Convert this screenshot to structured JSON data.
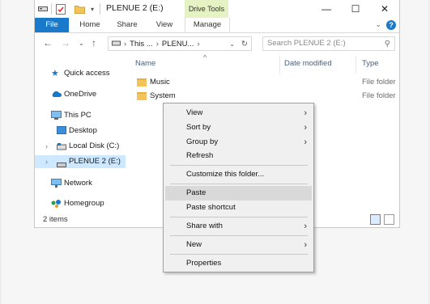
{
  "window": {
    "title": "PLENUE 2 (E:)",
    "context_tab": "Drive Tools",
    "controls": {
      "minimize": "—",
      "maximize": "☐",
      "close": "✕"
    }
  },
  "ribbon": {
    "tabs": [
      "File",
      "Home",
      "Share",
      "View",
      "Manage"
    ],
    "accent": "#1979ca",
    "context_tab_color": "#e5f2c4"
  },
  "address": {
    "segments": [
      "This ...",
      "PLENU..."
    ],
    "search_placeholder": "Search PLENUE 2 (E:)"
  },
  "nav": {
    "items": [
      {
        "label": "Quick access",
        "icon": "star-icon"
      },
      {
        "label": "OneDrive",
        "icon": "cloud-icon"
      },
      {
        "label": "This PC",
        "icon": "computer-icon"
      },
      {
        "label": "Desktop",
        "icon": "desktop-icon"
      },
      {
        "label": "Local Disk (C:)",
        "icon": "drive-icon"
      },
      {
        "label": "PLENUE 2 (E:)",
        "icon": "usb-drive-icon",
        "selected": true
      },
      {
        "label": "Network",
        "icon": "network-icon"
      },
      {
        "label": "Homegroup",
        "icon": "homegroup-icon"
      }
    ]
  },
  "files": {
    "columns": [
      "Name",
      "Date modified",
      "Type"
    ],
    "rows": [
      {
        "name": "Music",
        "type": "File folder"
      },
      {
        "name": "System",
        "type": "File folder"
      }
    ]
  },
  "status": {
    "items": "2 items"
  },
  "context_menu": {
    "items": [
      "View",
      "Sort by",
      "Group by",
      "Refresh",
      "Customize this folder...",
      "Paste",
      "Paste shortcut",
      "Share with",
      "New",
      "Properties"
    ],
    "highlighted": "Paste"
  }
}
